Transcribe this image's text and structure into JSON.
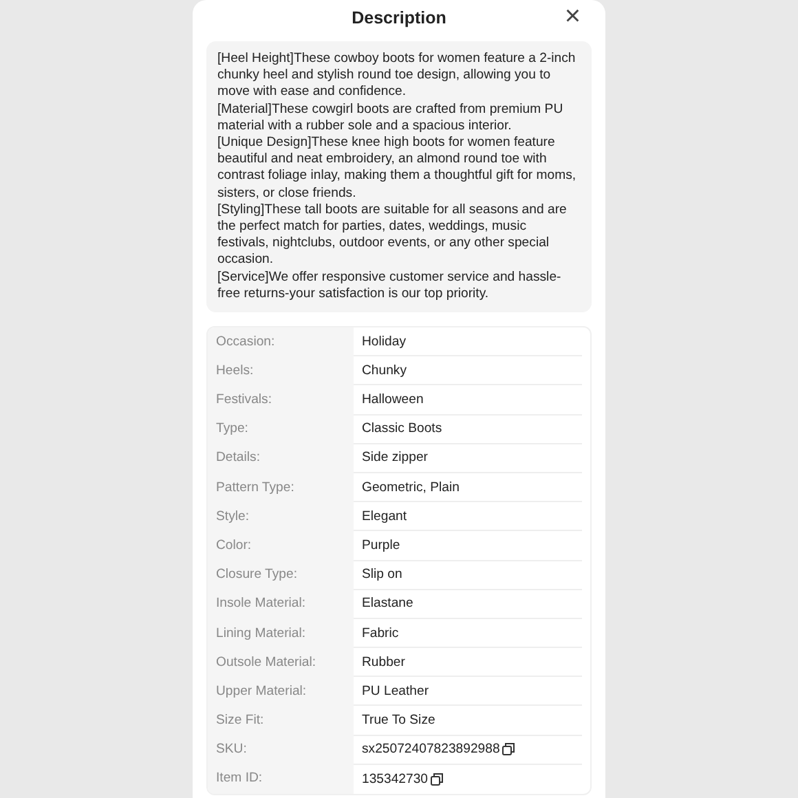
{
  "dialog": {
    "title": "Description",
    "close": "×"
  },
  "description": [
    "[Heel Height]These cowboy boots for women feature a 2-inch chunky heel and stylish round toe design, allowing you to move with ease and confidence.",
    "[Material]These cowgirl boots are crafted from premium PU material with a rubber sole and a spacious interior.",
    "[Unique Design]These knee high boots for women feature beautiful and neat embroidery, an almond round toe with contrast foliage inlay, making them a thoughtful gift for moms, sisters, or close friends.",
    "[Styling]These tall boots are suitable for all seasons and are the perfect match for parties, dates, weddings, music festivals, nightclubs, outdoor events, or any other special occasion.",
    "[Service]We offer responsive customer service and hassle-free returns-your satisfaction is our top priority."
  ],
  "attributes": [
    {
      "label": "Occasion:",
      "value": "Holiday",
      "copyable": false
    },
    {
      "label": "Heels:",
      "value": "Chunky",
      "copyable": false
    },
    {
      "label": "Festivals:",
      "value": "Halloween",
      "copyable": false
    },
    {
      "label": "Type:",
      "value": "Classic Boots",
      "copyable": false
    },
    {
      "label": "Details:",
      "value": "Side zipper",
      "copyable": false
    },
    {
      "label": "Pattern Type:",
      "value": "Geometric, Plain",
      "copyable": false
    },
    {
      "label": "Style:",
      "value": "Elegant",
      "copyable": false
    },
    {
      "label": "Color:",
      "value": "Purple",
      "copyable": false
    },
    {
      "label": "Closure Type:",
      "value": "Slip on",
      "copyable": false
    },
    {
      "label": "Insole Material:",
      "value": "Elastane",
      "copyable": false
    },
    {
      "label": "Lining Material:",
      "value": "Fabric",
      "copyable": false
    },
    {
      "label": "Outsole Material:",
      "value": "Rubber",
      "copyable": false
    },
    {
      "label": "Upper Material:",
      "value": "PU Leather",
      "copyable": false
    },
    {
      "label": "Size Fit:",
      "value": "True To Size",
      "copyable": false
    },
    {
      "label": "SKU:",
      "value": "sx25072407823892988",
      "copyable": true
    },
    {
      "label": "Item ID:",
      "value": "135342730",
      "copyable": true
    }
  ]
}
